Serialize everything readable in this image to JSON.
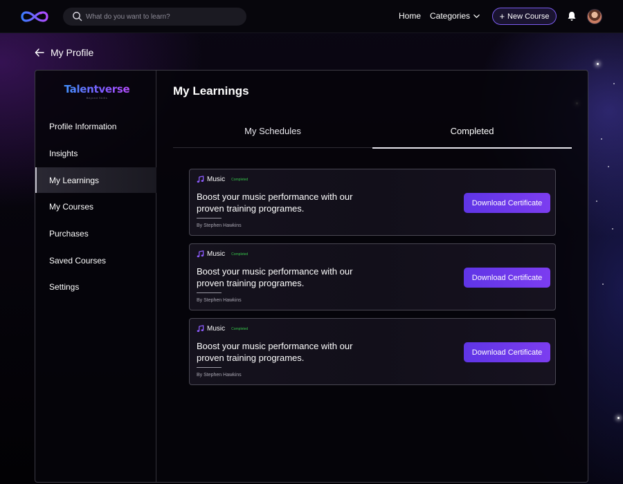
{
  "header": {
    "search_placeholder": "What do you want to learn?",
    "nav_home": "Home",
    "nav_categories": "Categories",
    "new_course_label": "New Course"
  },
  "page": {
    "back_title": "My Profile"
  },
  "brand": {
    "name": "Talentverse",
    "tagline": "Beyond Skills"
  },
  "sidebar": {
    "items": [
      {
        "label": "Profile Information"
      },
      {
        "label": "Insights"
      },
      {
        "label": "My Learnings"
      },
      {
        "label": "My Courses"
      },
      {
        "label": "Purchases"
      },
      {
        "label": "Saved Courses"
      },
      {
        "label": "Settings"
      }
    ],
    "active_index": 2
  },
  "main": {
    "title": "My Learnings",
    "tabs": [
      {
        "label": "My Schedules"
      },
      {
        "label": "Completed"
      }
    ],
    "active_tab": 1,
    "cards": [
      {
        "category": "Music",
        "status": "Completed",
        "title": "Boost your music performance with our proven training programes.",
        "author": "By Stephen Hawkins",
        "button": "Download Certificate"
      },
      {
        "category": "Music",
        "status": "Completed",
        "title": "Boost your music performance with our proven training programes.",
        "author": "By Stephen Hawkins",
        "button": "Download Certificate"
      },
      {
        "category": "Music",
        "status": "Completed",
        "title": "Boost your music performance with our proven training programes.",
        "author": "By Stephen Hawkins",
        "button": "Download Certificate"
      }
    ]
  },
  "colors": {
    "accent": "#6e3aeb",
    "status_completed": "#36c24a",
    "background": "#05040a"
  },
  "icons": {
    "logo": "infinity-logo-icon",
    "search": "search-icon",
    "categories": "chevron-down-icon",
    "new_course": "plus-icon",
    "notifications": "bell-icon",
    "back": "arrow-left-icon",
    "category": "music-note-icon"
  }
}
